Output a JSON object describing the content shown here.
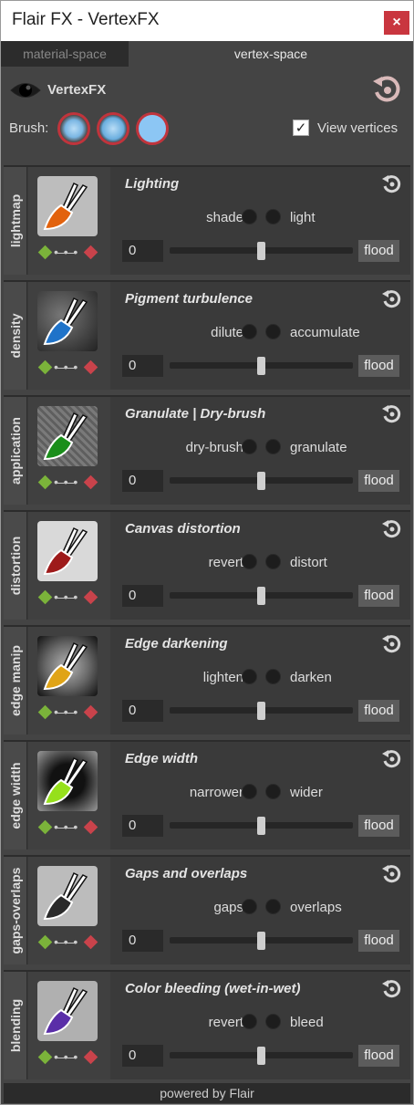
{
  "window": {
    "title": "Flair FX - VertexFX",
    "close_label": "×"
  },
  "tabs": [
    {
      "label": "material-space"
    },
    {
      "label": "vertex-space"
    }
  ],
  "header": {
    "title": "VertexFX",
    "brush_label": "Brush:",
    "view_vertices_label": "View vertices",
    "view_vertices_checked": true
  },
  "panels": [
    {
      "tab": "lightmap",
      "title": "Lighting",
      "left": "shade",
      "right": "light",
      "value": "0",
      "flood": "flood",
      "color": "#e2620d"
    },
    {
      "tab": "density",
      "title": "Pigment turbulence",
      "left": "dilute",
      "right": "accumulate",
      "value": "0",
      "flood": "flood",
      "color": "#1f73c9"
    },
    {
      "tab": "application",
      "title": "Granulate | Dry-brush",
      "left": "dry-brush",
      "right": "granulate",
      "value": "0",
      "flood": "flood",
      "color": "#1b8e1b"
    },
    {
      "tab": "distortion",
      "title": "Canvas distortion",
      "left": "revert",
      "right": "distort",
      "value": "0",
      "flood": "flood",
      "color": "#9e1b1b"
    },
    {
      "tab": "edge manip",
      "title": "Edge darkening",
      "left": "lighten",
      "right": "darken",
      "value": "0",
      "flood": "flood",
      "color": "#e0a417"
    },
    {
      "tab": "edge width",
      "title": "Edge width",
      "left": "narrower",
      "right": "wider",
      "value": "0",
      "flood": "flood",
      "color": "#96e01b"
    },
    {
      "tab": "gaps-overlaps",
      "title": "Gaps and overlaps",
      "left": "gaps",
      "right": "overlaps",
      "value": "0",
      "flood": "flood",
      "color": "#2a2a2a"
    },
    {
      "tab": "blending",
      "title": "Color bleeding (wet-in-wet)",
      "left": "revert",
      "right": "bleed",
      "value": "0",
      "flood": "flood",
      "color": "#5a2ea8"
    }
  ],
  "footer": {
    "text": "powered by Flair"
  }
}
